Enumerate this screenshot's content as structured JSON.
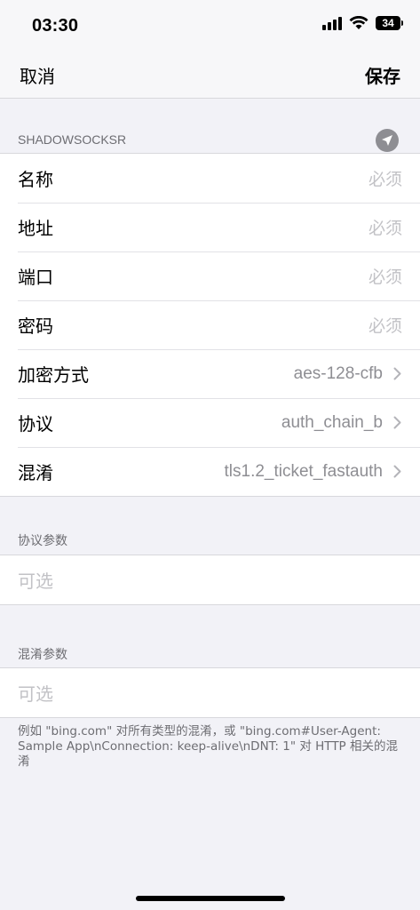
{
  "status_bar": {
    "time": "03:30",
    "battery_level": "34",
    "icons": [
      "cellular-signal-icon",
      "wifi-icon",
      "battery-icon"
    ]
  },
  "nav": {
    "cancel_label": "取消",
    "save_label": "保存"
  },
  "server_section": {
    "header": "SHADOWSOCKSR",
    "header_icon": "send-location-icon",
    "rows": [
      {
        "label": "名称",
        "placeholder": "必须"
      },
      {
        "label": "地址",
        "placeholder": "必须"
      },
      {
        "label": "端口",
        "placeholder": "必须"
      },
      {
        "label": "密码",
        "placeholder": "必须"
      },
      {
        "label": "加密方式",
        "value": "aes-128-cfb"
      },
      {
        "label": "协议",
        "value": "auth_chain_b"
      },
      {
        "label": "混淆",
        "value": "tls1.2_ticket_fastauth"
      }
    ]
  },
  "protocol_params": {
    "header": "协议参数",
    "placeholder": "可选"
  },
  "obfs_params": {
    "header": "混淆参数",
    "placeholder": "可选",
    "note": "例如 \"bing.com\" 对所有类型的混淆，或 \"bing.com#User-Agent: Sample App\\nConnection: keep-alive\\nDNT: 1\" 对 HTTP 相关的混淆"
  },
  "colors": {
    "background": "#f2f2f7",
    "placeholder": "#c2c2c6",
    "secondary_text": "#6d6d72"
  }
}
